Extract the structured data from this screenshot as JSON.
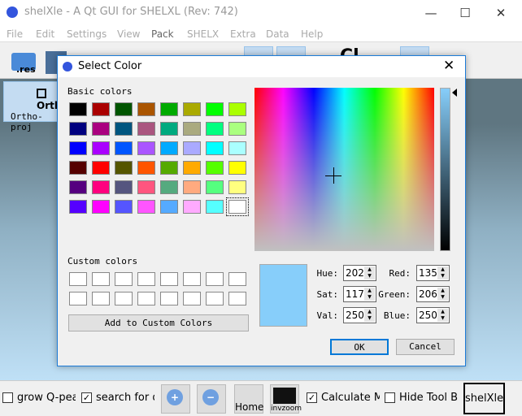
{
  "window": {
    "title": "shelXle - A Qt GUI for SHELXL (Rev: 742)",
    "minimize_icon": "minimize-icon",
    "maximize_icon": "maximize-icon",
    "close_icon": "close-icon"
  },
  "menu": [
    "File",
    "Edit",
    "Settings",
    "View",
    "Pack",
    "SHELX",
    "Extra",
    "Data",
    "Help"
  ],
  "toolbar": {
    "res_label": ".res"
  },
  "side": {
    "title": "Orth",
    "subtitle": "Ortho-proj"
  },
  "dialog": {
    "title": "Select Color",
    "basic_label": "Basic colors",
    "basic_colors": [
      "#000000",
      "#aa0000",
      "#005500",
      "#aa5500",
      "#00aa00",
      "#aaaa00",
      "#00ff00",
      "#aaff00",
      "#00007f",
      "#aa007f",
      "#00557f",
      "#aa557f",
      "#00aa7f",
      "#aaaa7f",
      "#00ff7f",
      "#aaff7f",
      "#0000ff",
      "#aa00ff",
      "#0055ff",
      "#aa55ff",
      "#00aaff",
      "#aaaaff",
      "#00ffff",
      "#aaffff",
      "#550000",
      "#ff0000",
      "#555500",
      "#ff5500",
      "#55aa00",
      "#ffaa00",
      "#55ff00",
      "#ffff00",
      "#55007f",
      "#ff007f",
      "#55557f",
      "#ff557f",
      "#55aa7f",
      "#ffaa7f",
      "#55ff7f",
      "#ffff7f",
      "#5500ff",
      "#ff00ff",
      "#5555ff",
      "#ff55ff",
      "#55aaff",
      "#ffaaff",
      "#55ffff",
      "#ffffff"
    ],
    "selected_basic": "#ffffff",
    "custom_label": "Custom colors",
    "add_custom": "Add to Custom Colors",
    "current_color": "#87cefa",
    "fields": {
      "hue_label": "Hue:",
      "hue": "202",
      "sat_label": "Sat:",
      "sat": "117",
      "val_label": "Val:",
      "val": "250",
      "red_label": "Red:",
      "red": "135",
      "green_label": "Green:",
      "green": "206",
      "blue_label": "Blue:",
      "blue": "250"
    },
    "ok": "OK",
    "cancel": "Cancel"
  },
  "bottom": {
    "grow": "grow Q-pea",
    "grow_checked": false,
    "search": "search for d",
    "search_checked": true,
    "home": "Home",
    "invzoom": "invzoom",
    "calc": "Calculate Ma",
    "calc_checked": true,
    "hide": "Hide Tool Ba",
    "hide_checked": false,
    "shelxle": "shelXle"
  }
}
